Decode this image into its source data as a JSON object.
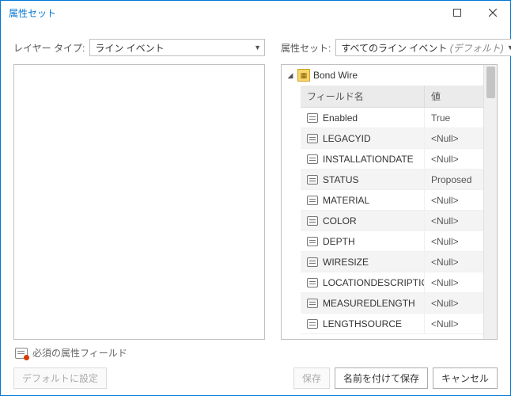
{
  "window": {
    "title": "属性セット"
  },
  "top": {
    "layer_type_label": "レイヤー タイプ:",
    "layer_type_value": "ライン イベント",
    "attr_set_label": "属性セット:",
    "attr_set_value": "すべてのライン イベント",
    "attr_set_default": "(デフォルト)"
  },
  "tree": {
    "root_label": "Bond Wire",
    "header_field": "フィールド名",
    "header_value": "値",
    "rows": [
      {
        "field": "Enabled",
        "value": "True"
      },
      {
        "field": "LEGACYID",
        "value": "<Null>"
      },
      {
        "field": "INSTALLATIONDATE",
        "value": "<Null>"
      },
      {
        "field": "STATUS",
        "value": "Proposed"
      },
      {
        "field": "MATERIAL",
        "value": "<Null>"
      },
      {
        "field": "COLOR",
        "value": "<Null>"
      },
      {
        "field": "DEPTH",
        "value": "<Null>"
      },
      {
        "field": "WIRESIZE",
        "value": "<Null>"
      },
      {
        "field": "LOCATIONDESCRIPTION",
        "value": "<Null>"
      },
      {
        "field": "MEASUREDLENGTH",
        "value": "<Null>"
      },
      {
        "field": "LENGTHSOURCE",
        "value": "<Null>"
      }
    ]
  },
  "legend": {
    "required_label": "必須の属性フィールド"
  },
  "buttons": {
    "set_default": "デフォルトに設定",
    "save": "保存",
    "save_as": "名前を付けて保存",
    "cancel": "キャンセル"
  }
}
